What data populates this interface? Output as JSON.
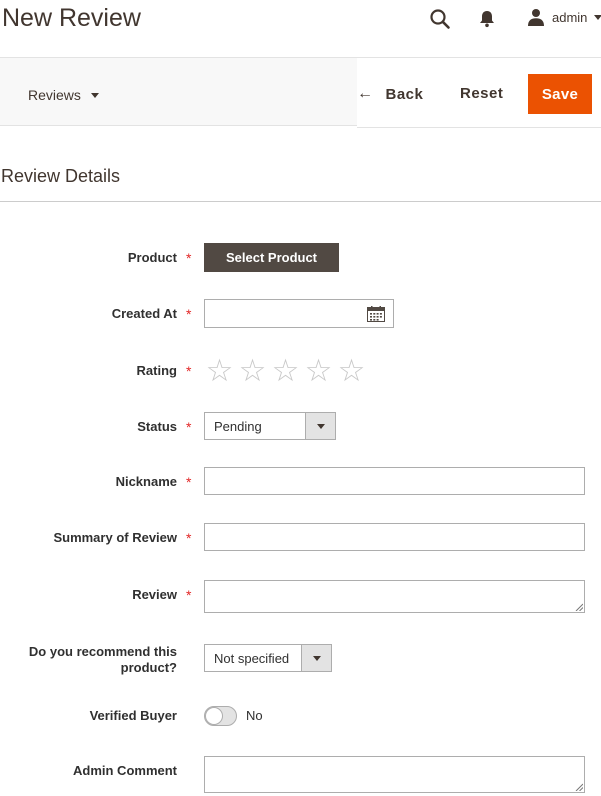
{
  "header": {
    "title": "New Review",
    "user_label": "admin"
  },
  "action_bar": {
    "store_switcher": "Reviews",
    "back_label": "Back",
    "reset_label": "Reset",
    "save_label": "Save"
  },
  "section": {
    "title": "Review Details"
  },
  "form": {
    "product": {
      "label": "Product",
      "required_mark": "*",
      "button_label": "Select Product"
    },
    "created_at": {
      "label": "Created At",
      "required_mark": "*",
      "value": ""
    },
    "rating": {
      "label": "Rating",
      "required_mark": "*",
      "max": 5,
      "selected": 0
    },
    "status": {
      "label": "Status",
      "required_mark": "*",
      "value": "Pending"
    },
    "nickname": {
      "label": "Nickname",
      "required_mark": "*",
      "value": ""
    },
    "summary": {
      "label": "Summary of Review",
      "required_mark": "*",
      "value": ""
    },
    "review": {
      "label": "Review",
      "required_mark": "*",
      "value": ""
    },
    "recommend": {
      "label_line1": "Do you recommend this",
      "label_line2": "product?",
      "value": "Not specified"
    },
    "verified_buyer": {
      "label": "Verified Buyer",
      "state_label": "No",
      "checked": false
    },
    "admin_comment": {
      "label": "Admin Comment",
      "value": ""
    }
  },
  "colors": {
    "primary_action": "#eb5202",
    "secondary_button": "#514943",
    "required": "#e22626"
  }
}
